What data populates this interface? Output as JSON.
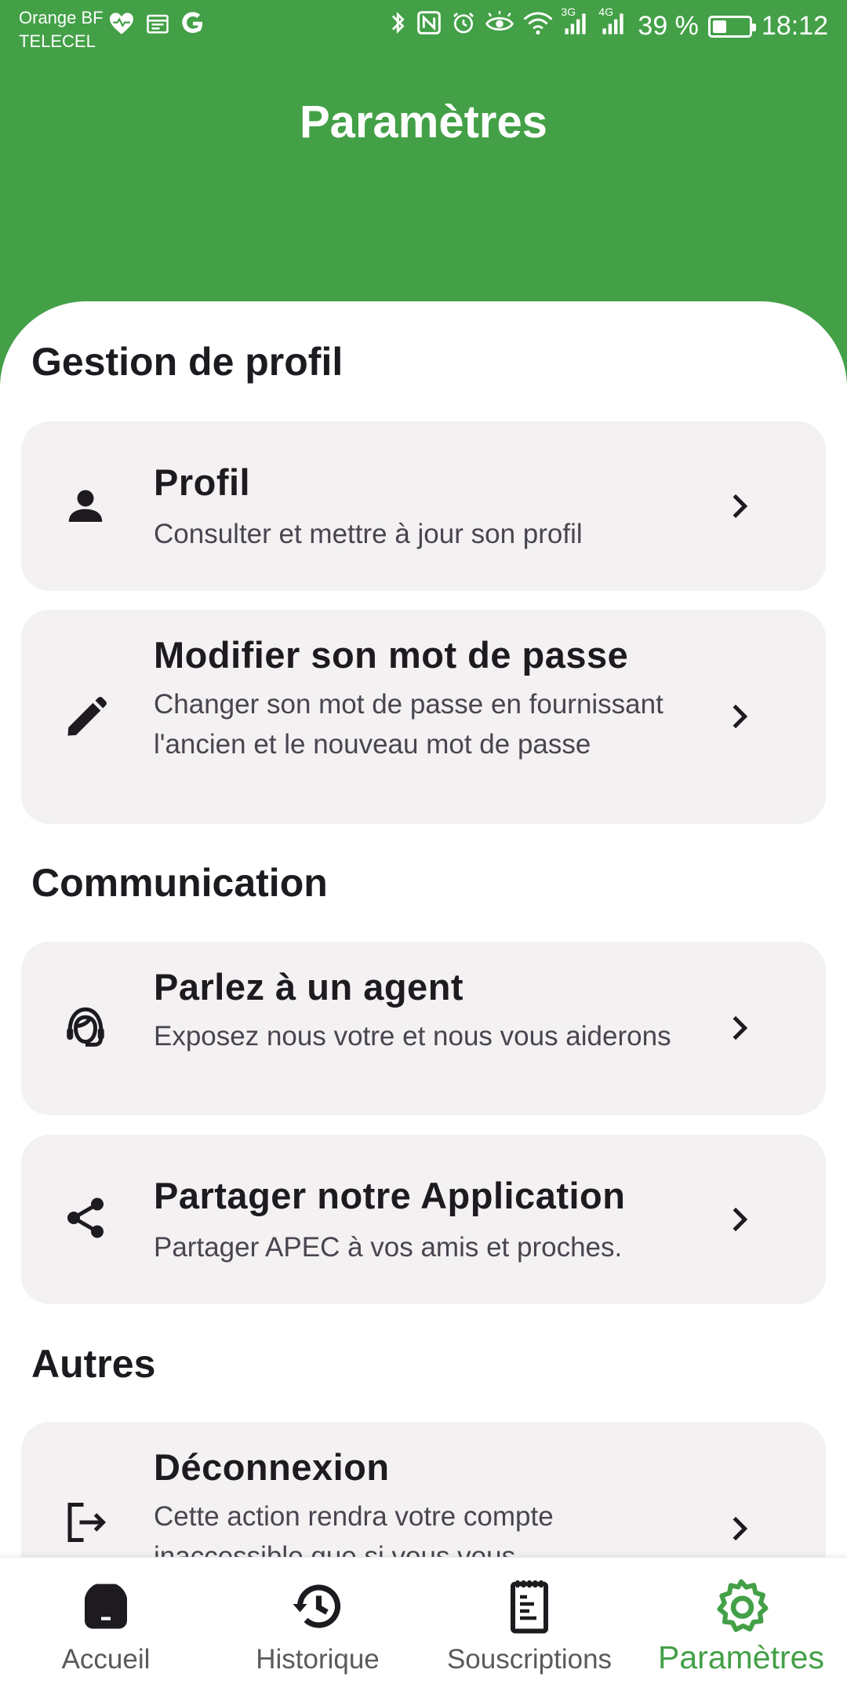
{
  "status_bar": {
    "carrier_line1": "Orange BF",
    "carrier_line2": "TELECEL",
    "battery_text": "39 %",
    "battery_level": 0.39,
    "time": "18:12",
    "network_3g": "3G",
    "network_4g": "4G"
  },
  "header": {
    "title": "Paramètres"
  },
  "sections": [
    {
      "title": "Gestion de profil",
      "items": [
        {
          "title": "Profil",
          "subtitle": "Consulter et mettre à jour son profil",
          "icon": "person-icon"
        },
        {
          "title": "Modifier son mot de passe",
          "subtitle": "Changer son mot de passe en fournissant l'ancien et le nouveau mot de passe",
          "icon": "edit-pencil-icon"
        }
      ]
    },
    {
      "title": "Communication",
      "items": [
        {
          "title": "Parlez à un agent",
          "subtitle": "Exposez nous votre et nous vous aiderons",
          "icon": "support-agent-icon"
        },
        {
          "title": "Partager notre Application",
          "subtitle": "Partager APEC à vos amis et proches.",
          "icon": "share-icon"
        }
      ]
    },
    {
      "title": "Autres",
      "items": [
        {
          "title": "Déconnexion",
          "subtitle": "Cette action rendra votre compte inaccessible que si vous vous",
          "icon": "logout-icon"
        }
      ]
    }
  ],
  "bottom_nav": {
    "items": [
      {
        "label": "Accueil",
        "icon": "home-icon",
        "active": false
      },
      {
        "label": "Historique",
        "icon": "history-icon",
        "active": false
      },
      {
        "label": "Souscriptions",
        "icon": "receipt-icon",
        "active": false
      },
      {
        "label": "Paramètres",
        "icon": "settings-gear-icon",
        "active": true
      }
    ]
  },
  "colors": {
    "primary": "#43a047",
    "card_bg": "#f3f1f2",
    "text": "#1d1b20",
    "subtext": "#49454f"
  }
}
